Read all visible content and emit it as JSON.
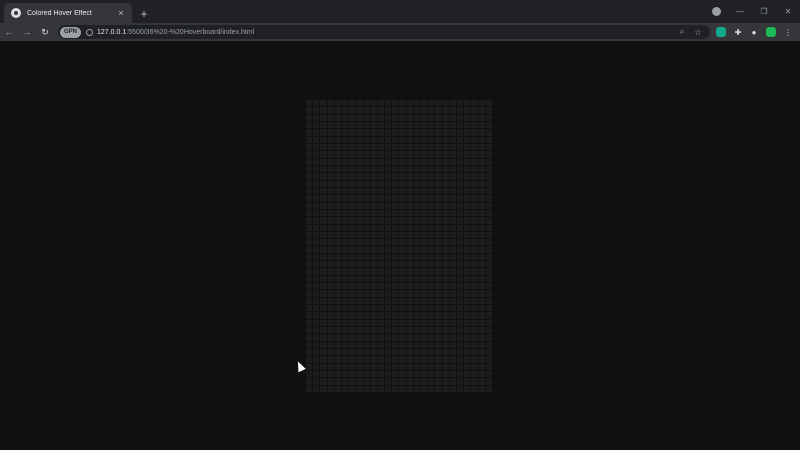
{
  "tab": {
    "title": "Colored Hover Effect",
    "close": "×"
  },
  "new_tab": "+",
  "window": {
    "minimize": "—",
    "restore": "❐",
    "close": "✕"
  },
  "nav": {
    "back": "←",
    "forward": "→",
    "reload": "↻"
  },
  "omnibox": {
    "extension_pill": "GPN",
    "url_host": "127.0.0.1",
    "url_path": ":5500/36%20-%20Hoverboard/index.html",
    "zoom_icon": "⌕",
    "bookmark_icon": "☆"
  },
  "toolbar_icons": {
    "puzzle": "✚",
    "profile": "●",
    "menu": "⋮"
  },
  "colors": {
    "background": "#111111",
    "cell": "#1d1d1d",
    "ext_green": "#1db954",
    "ext_teal": "#13a88a"
  },
  "grid": {
    "columns": 26,
    "rows": 40
  }
}
